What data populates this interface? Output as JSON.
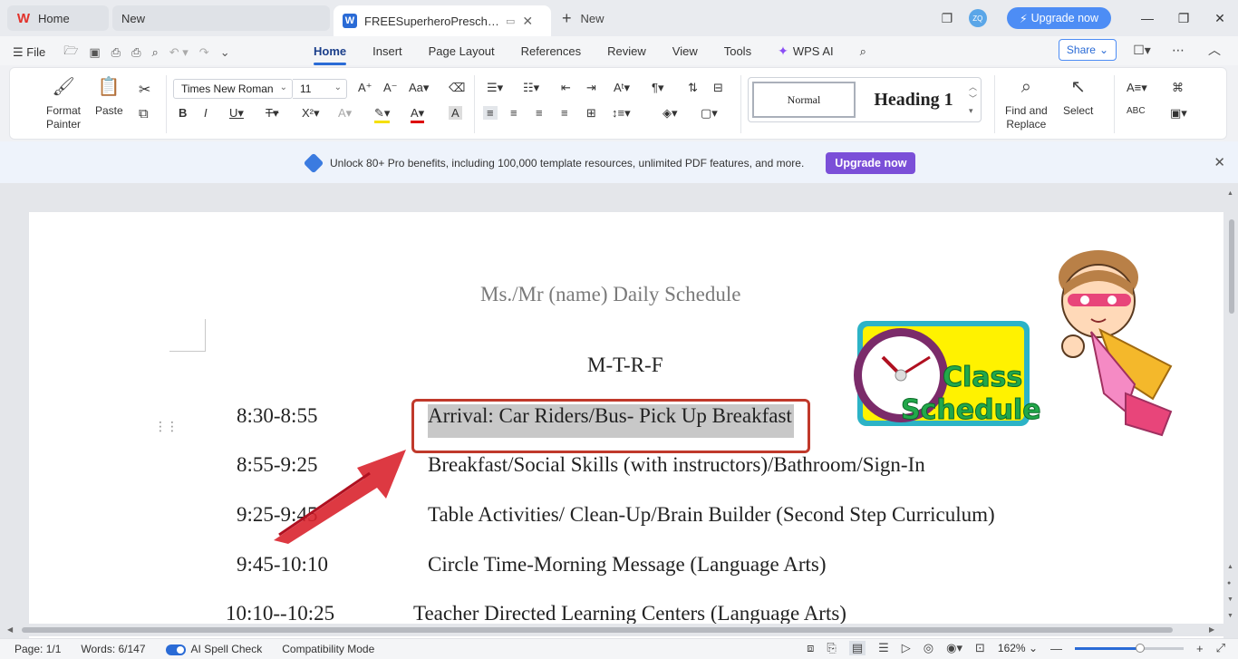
{
  "titlebar": {
    "tabs": [
      {
        "label": "Home",
        "icon": "wps-logo-icon"
      },
      {
        "label": "New"
      },
      {
        "label": "FREESuperheroPreschoolSchedule",
        "icon": "writer-doc-icon",
        "active": true
      }
    ],
    "new_tab_label": "New",
    "avatar_initials": "ZQ",
    "upgrade_label": "Upgrade now"
  },
  "menubar": {
    "file_label": "File",
    "tabs": [
      "Home",
      "Insert",
      "Page Layout",
      "References",
      "Review",
      "View",
      "Tools"
    ],
    "active_tab": "Home",
    "wps_ai_label": "WPS AI",
    "share_label": "Share"
  },
  "ribbon": {
    "format_painter_line1": "Format",
    "format_painter_line2": "Painter",
    "paste_label": "Paste",
    "font_name": "Times New Roman",
    "font_size": "11",
    "style_normal": "Normal",
    "style_heading1": "Heading 1",
    "find_replace_line1": "Find and",
    "find_replace_line2": "Replace",
    "select_label": "Select"
  },
  "promo": {
    "text": "Unlock 80+ Pro benefits, including 100,000 template resources, unlimited PDF features, and more.",
    "button": "Upgrade now"
  },
  "document": {
    "title": "Ms./Mr (name) Daily Schedule",
    "days": "M-T-R-F",
    "rows": [
      {
        "time": "8:30-8:55",
        "activity": "Arrival: Car Riders/Bus- Pick Up Breakfast"
      },
      {
        "time": "8:55-9:25",
        "activity": "Breakfast/Social Skills (with instructors)/Bathroom/Sign-In"
      },
      {
        "time": "9:25-9:45",
        "activity": "Table Activities/ Clean-Up/Brain Builder (Second Step Curriculum)"
      },
      {
        "time": "9:45-10:10",
        "activity": "Circle Time-Morning Message (Language Arts)"
      },
      {
        "time": "10:10--10:25",
        "activity": "Teacher Directed Learning Centers (Language Arts)"
      }
    ],
    "clipart_line1": "Class",
    "clipart_line2": "Schedule"
  },
  "statusbar": {
    "page": "Page: 1/1",
    "words": "Words: 6/147",
    "spell_check": "AI Spell Check",
    "mode": "Compatibility Mode",
    "zoom": "162%",
    "zoom_level": 0.6
  },
  "colors": {
    "accent": "#2a6bd6",
    "upgrade_top": "#4d8df5",
    "promo_button": "#7b4fd8",
    "callout_border": "#c0392b",
    "arrow_red": "#d9232e"
  }
}
